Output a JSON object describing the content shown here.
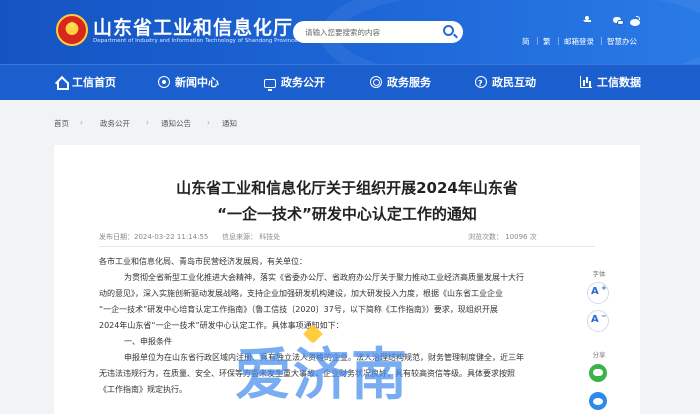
{
  "header": {
    "site_title": "山东省工业和信息化厅",
    "site_subtitle": "Department of Industry and Information Technology of Shandong Province",
    "search_placeholder": "请输入您要搜索的内容",
    "links": [
      "简",
      "|",
      "繁",
      "|",
      "邮箱登录",
      "|",
      "智慧办公"
    ]
  },
  "nav": [
    {
      "label": "工信首页",
      "icon": "home-icon"
    },
    {
      "label": "新闻中心",
      "icon": "news-icon"
    },
    {
      "label": "政务公开",
      "icon": "gov-icon"
    },
    {
      "label": "政务服务",
      "icon": "service-icon"
    },
    {
      "label": "政民互动",
      "icon": "interaction-icon"
    },
    {
      "label": "工信数据",
      "icon": "data-icon"
    }
  ],
  "breadcrumb": [
    "首页",
    "›",
    "政务公开",
    "›",
    "通知公告",
    "›",
    "通知"
  ],
  "article": {
    "title_line1": "山东省工业和信息化厅关于组织开展2024年山东省",
    "title_line2": "“一企一技术”研发中心认定工作的通知",
    "publish_time": "发布日期：2024-03-22 11:14:55",
    "source": "信息来源：  科技处",
    "views_label": "浏览次数：  10096   次",
    "paragraphs": [
      "各市工业和信息化局、青岛市民营经济发展局，有关单位：",
      "为贯彻全省新型工业化推进大会精神，落实《省委办公厅、省政府办公厅关于聚力推动工业经济高质量发展十大行",
      "动的意见》，深入实施创新驱动发展战略，支持企业加强研发机构建设，加大研发投入力度，根据《山东省工业企业",
      "“一企一技术”研发中心培育认定工作指南》（鲁工信技〔2020〕37号，以下简称《工作指南》）要求，现组织开展",
      "2024年山东省“一企一技术”研发中心认定工作。具体事项通知如下：",
      "一、申报条件",
      "申报单位为在山东省行政区域内注册、具有独立法人资格的企业。法人治理结构规范，财务管理制度健全，近三年",
      "无违法违规行为，在质量、安全、环保等方面未发生重大事故，企业财务状况良好，具有较高资信等级。具体要求按照",
      "《工作指南》规定执行。"
    ]
  },
  "side": {
    "font_label": "字体",
    "share_label": "分享",
    "font_increase": "A",
    "font_decrease": "A",
    "plus": "+",
    "minus": "−"
  },
  "watermark": "爱济南",
  "colors": {
    "header_blue": "#1b5fcf",
    "nav_blue": "#1b5fcf",
    "background": "#f2f3f5"
  }
}
